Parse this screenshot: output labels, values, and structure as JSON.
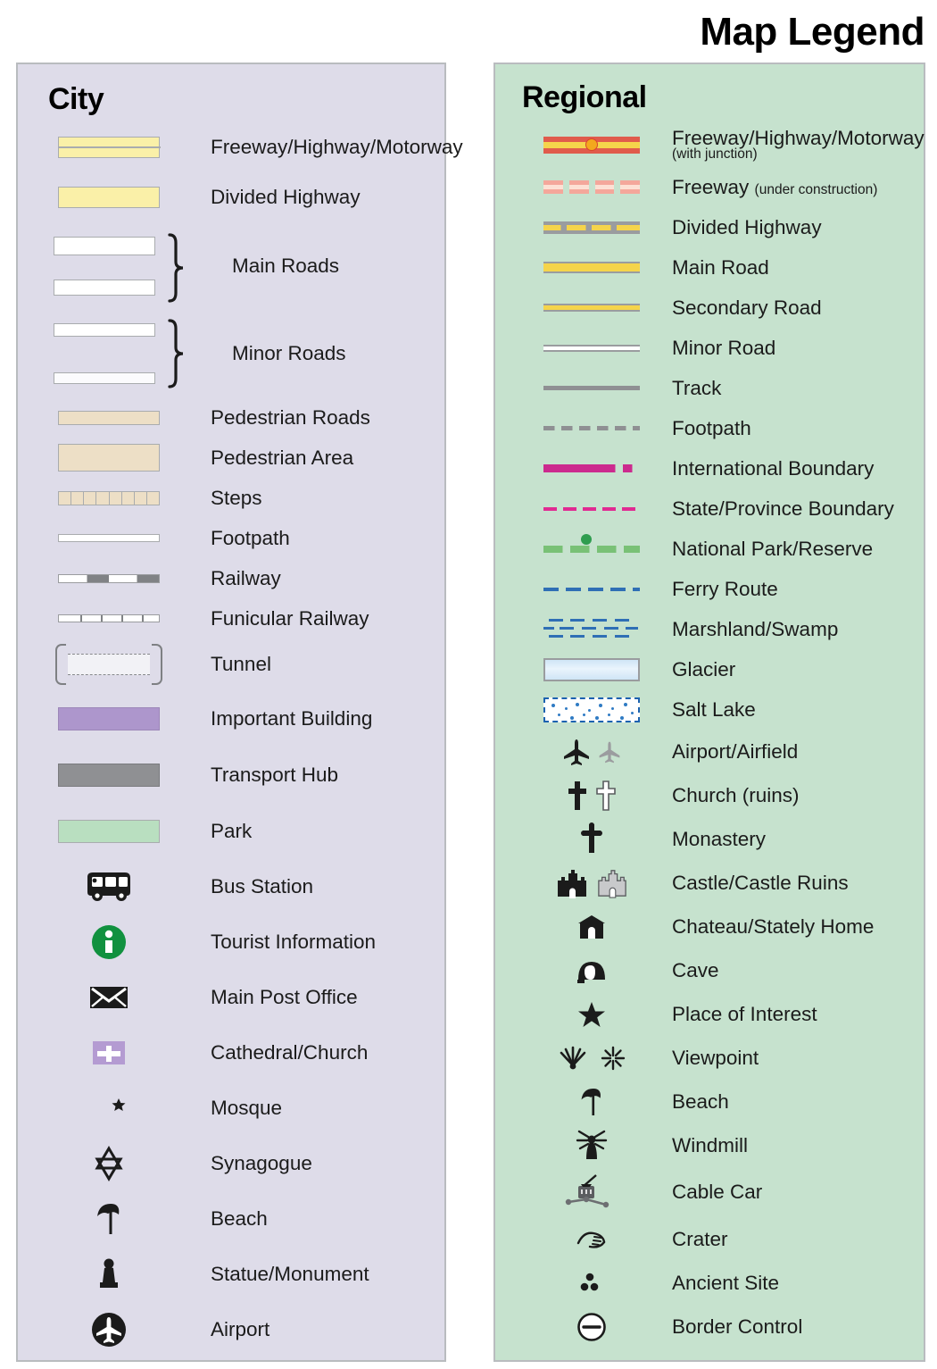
{
  "title": "Map Legend",
  "city": {
    "heading": "City",
    "bg_color": "#dedce9",
    "items": [
      {
        "symbol": "freeway-bar",
        "label": "Freeway/Highway/Motorway"
      },
      {
        "symbol": "divided-highway-bar",
        "label": "Divided Highway"
      },
      {
        "symbol": "main-roads-braced",
        "label": "Main Roads"
      },
      {
        "symbol": "minor-roads-braced",
        "label": "Minor Roads"
      },
      {
        "symbol": "pedestrian-road-bar",
        "label": "Pedestrian Roads"
      },
      {
        "symbol": "pedestrian-area-bar",
        "label": "Pedestrian Area"
      },
      {
        "symbol": "steps-bar",
        "label": "Steps"
      },
      {
        "symbol": "footpath-line",
        "label": "Footpath"
      },
      {
        "symbol": "railway-line",
        "label": "Railway"
      },
      {
        "symbol": "funicular-line",
        "label": "Funicular Railway"
      },
      {
        "symbol": "tunnel-brackets",
        "label": "Tunnel"
      },
      {
        "symbol": "important-building-bar",
        "label": "Important Building"
      },
      {
        "symbol": "transport-hub-bar",
        "label": "Transport Hub"
      },
      {
        "symbol": "park-bar",
        "label": "Park"
      },
      {
        "symbol": "bus-icon",
        "label": "Bus Station"
      },
      {
        "symbol": "information-icon",
        "label": "Tourist Information"
      },
      {
        "symbol": "envelope-icon",
        "label": "Main Post Office"
      },
      {
        "symbol": "cross-square-icon",
        "label": "Cathedral/Church"
      },
      {
        "symbol": "crescent-star-icon",
        "label": "Mosque"
      },
      {
        "symbol": "star-of-david-icon",
        "label": "Synagogue"
      },
      {
        "symbol": "parasol-icon",
        "label": "Beach"
      },
      {
        "symbol": "statue-icon",
        "label": "Statue/Monument"
      },
      {
        "symbol": "airplane-circle-icon",
        "label": "Airport"
      }
    ]
  },
  "regional": {
    "heading": "Regional",
    "bg_color": "#c6e2ce",
    "items": [
      {
        "symbol": "freeway-junction-line",
        "label": "Freeway/Highway/Motorway",
        "sublabel": "(with junction)"
      },
      {
        "symbol": "freeway-dashed-line",
        "label": "Freeway",
        "inline_note": "(under construction)"
      },
      {
        "symbol": "divided-highway-line",
        "label": "Divided Highway"
      },
      {
        "symbol": "main-road-line",
        "label": "Main Road"
      },
      {
        "symbol": "secondary-road-line",
        "label": "Secondary Road"
      },
      {
        "symbol": "minor-road-line",
        "label": "Minor Road"
      },
      {
        "symbol": "track-line",
        "label": "Track"
      },
      {
        "symbol": "footpath-dashed-line",
        "label": "Footpath"
      },
      {
        "symbol": "international-boundary-line",
        "label": "International Boundary"
      },
      {
        "symbol": "state-boundary-line",
        "label": "State/Province Boundary"
      },
      {
        "symbol": "national-park-line",
        "label": "National Park/Reserve"
      },
      {
        "symbol": "ferry-route-line",
        "label": "Ferry Route"
      },
      {
        "symbol": "marshland-pattern",
        "label": "Marshland/Swamp"
      },
      {
        "symbol": "glacier-swatch",
        "label": "Glacier"
      },
      {
        "symbol": "salt-lake-swatch",
        "label": "Salt Lake"
      },
      {
        "symbol": "airplane-pair-icon",
        "label": "Airport/Airfield"
      },
      {
        "symbol": "cross-pair-icon",
        "label": "Church (ruins)"
      },
      {
        "symbol": "monastery-cross-icon",
        "label": "Monastery"
      },
      {
        "symbol": "castle-pair-icon",
        "label": "Castle/Castle Ruins"
      },
      {
        "symbol": "chateau-icon",
        "label": "Chateau/Stately Home"
      },
      {
        "symbol": "cave-icon",
        "label": "Cave"
      },
      {
        "symbol": "star-icon",
        "label": "Place of Interest"
      },
      {
        "symbol": "viewpoint-pair-icon",
        "label": "Viewpoint"
      },
      {
        "symbol": "parasol-icon",
        "label": "Beach"
      },
      {
        "symbol": "windmill-icon",
        "label": "Windmill"
      },
      {
        "symbol": "cable-car-icon",
        "label": "Cable Car"
      },
      {
        "symbol": "crater-icon",
        "label": "Crater"
      },
      {
        "symbol": "ancient-site-icon",
        "label": "Ancient Site"
      },
      {
        "symbol": "border-control-icon",
        "label": "Border Control"
      }
    ]
  },
  "colors": {
    "city_panel": "#dedce9",
    "regional_panel": "#c6e2ce",
    "highway_yellow": "#faf0a8",
    "freeway_red": "#e05b4c",
    "junction_orange": "#f3a81e",
    "road_yellow": "#f5d44b",
    "pedestrian_tan": "#eddfc6",
    "park_green": "#b9dfc0",
    "important_building_purple": "#ad96cc",
    "transport_hub_gray": "#8f9093",
    "boundary_magenta": "#cc2a8e",
    "ferry_blue": "#2f6fb5",
    "national_park_green": "#79c176",
    "info_green": "#11913f"
  }
}
